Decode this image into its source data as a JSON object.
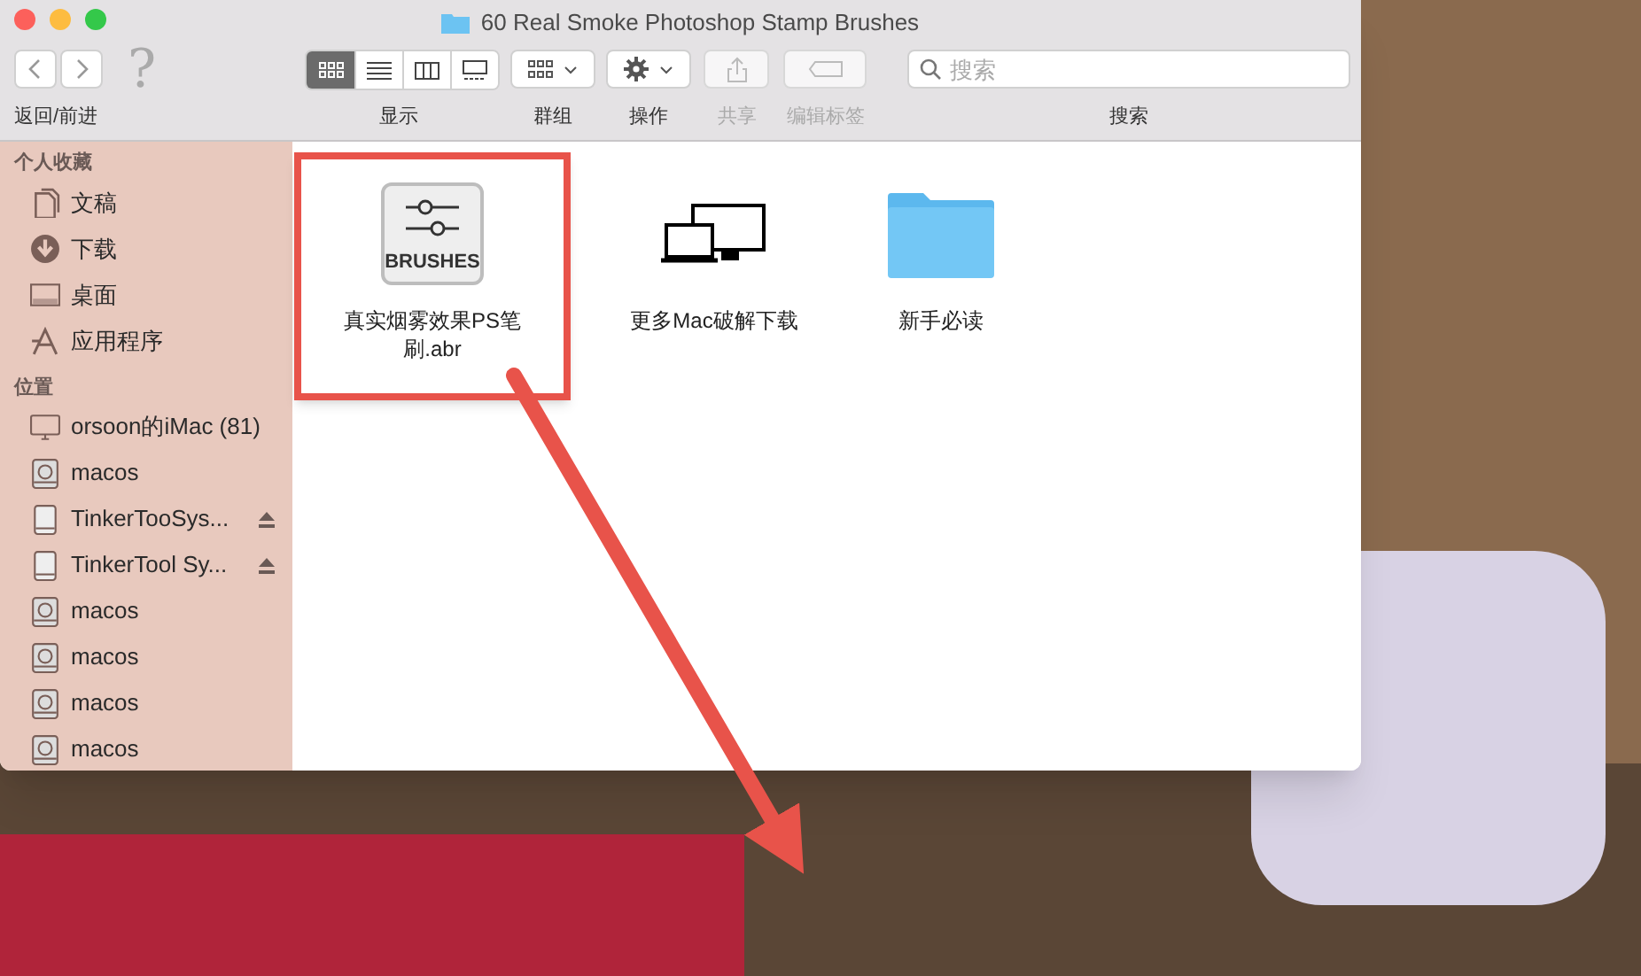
{
  "window": {
    "title": "60 Real Smoke Photoshop Stamp Brushes"
  },
  "toolbar": {
    "help_glyph": "?",
    "view_buttons": [
      {
        "kind": "icons",
        "selected": true
      },
      {
        "kind": "list",
        "selected": false
      },
      {
        "kind": "columns",
        "selected": false
      },
      {
        "kind": "gallery",
        "selected": false
      }
    ],
    "labels": [
      {
        "text": "返回/前进",
        "disabled": false
      },
      {
        "text": "显示",
        "disabled": false
      },
      {
        "text": "群组",
        "disabled": false
      },
      {
        "text": "操作",
        "disabled": false
      },
      {
        "text": "共享",
        "disabled": true
      },
      {
        "text": "编辑标签",
        "disabled": true
      },
      {
        "text": "搜索",
        "disabled": false
      }
    ],
    "search": {
      "placeholder": "搜索"
    }
  },
  "sidebar": {
    "sections": [
      {
        "title": "个人收藏",
        "items": [
          {
            "kind": "documents",
            "label": "文稿"
          },
          {
            "kind": "downloads",
            "label": "下载"
          },
          {
            "kind": "desktop",
            "label": "桌面"
          },
          {
            "kind": "apps",
            "label": "应用程序"
          }
        ]
      },
      {
        "title": "位置",
        "items": [
          {
            "kind": "computer",
            "label": "orsoon的iMac (81)"
          },
          {
            "kind": "disk",
            "label": "macos"
          },
          {
            "kind": "volume",
            "label": "TinkerTooSys...",
            "eject": true
          },
          {
            "kind": "volume",
            "label": "TinkerTool Sy...",
            "eject": true
          },
          {
            "kind": "disk",
            "label": "macos"
          },
          {
            "kind": "disk",
            "label": "macos"
          },
          {
            "kind": "disk",
            "label": "macos"
          },
          {
            "kind": "disk",
            "label": "macos"
          }
        ]
      }
    ]
  },
  "files": [
    {
      "kind": "brush",
      "icon_text": "BRUSHES",
      "name": "真实烟雾效果PS笔刷.abr",
      "highlighted": true
    },
    {
      "kind": "devices",
      "name": "更多Mac破解下载",
      "highlighted": false
    },
    {
      "kind": "folder",
      "name": "新手必读",
      "highlighted": false
    }
  ]
}
